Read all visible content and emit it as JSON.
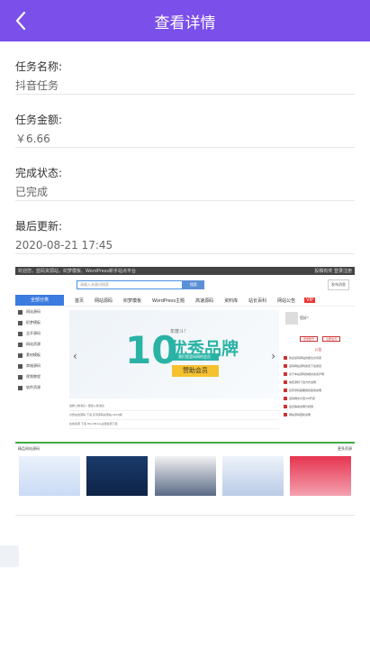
{
  "header": {
    "title": "查看详情"
  },
  "fields": [
    {
      "label": "任务名称:",
      "value": "抖音任务"
    },
    {
      "label": "任务金额:",
      "value": "￥6.66"
    },
    {
      "label": "完成状态:",
      "value": "已完成"
    },
    {
      "label": "最后更新:",
      "value": "2020-08-21 17:45"
    }
  ],
  "screenshot": {
    "topbar_left": "欢迎您，蓝码资源站，织梦模板、WordPress新手站点平台",
    "topbar_right": "投稿有奖  登录注册",
    "search_placeholder": "请输入关键词搜索",
    "search_button": "搜索",
    "publish_button": "发布消息",
    "nav": [
      "全部分类",
      "首页",
      "网站源码",
      "织梦模板",
      "WordPress主题",
      "高速源码",
      "资料库",
      "站长百科",
      "网站公告"
    ],
    "vip": "VIP",
    "categories": [
      "网站源码",
      "织梦模板",
      "全开源码",
      "网站资源",
      "素材模板",
      "商城源码",
      "视频教程",
      "软件资源"
    ],
    "banner_year": "年度斗！",
    "banner_num": "10",
    "banner_brand": "优秀品牌",
    "banner_tag": "我们是蓝码网的会员",
    "banner_help": "赞助会员",
    "user_label": "您好！",
    "user_btns": [
      "登录账号",
      "注册会员"
    ],
    "news_title": "公告",
    "news": [
      "欢迎蓝码网站的各位访问者",
      "蓝码网站源码免费下载通道",
      "关于本站源码的相关免责声明",
      "免费源码下载方式说明",
      "织梦源码需要授权使用说明",
      "蓝码网支付宝VIP开通",
      "会员等级说明与权限",
      "网站源码更新说明"
    ],
    "mid_lines": [
      "最新公告消息  /  更多公告消息",
      "付费在线源码 下载  高清源码资源站-2020版",
      "在线资源 下载  WordPress主题资源下载"
    ],
    "section_title": "精品网站源码",
    "section_more": "更多资源"
  },
  "colors": {
    "header": "#7b4fe9",
    "accent_teal": "#2ab3a5"
  }
}
